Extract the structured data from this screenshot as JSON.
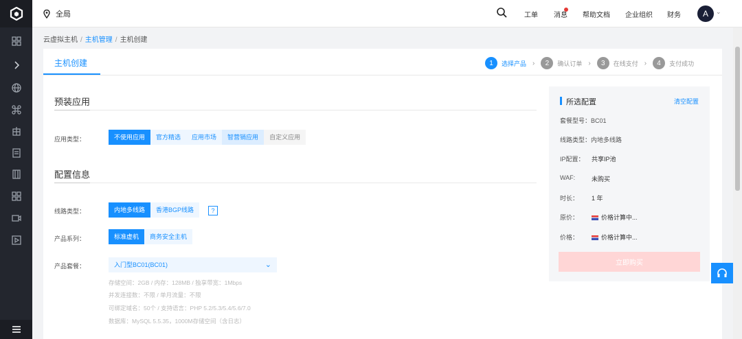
{
  "topbar": {
    "region": "全局",
    "nav": [
      "工单",
      "消息",
      "帮助文档",
      "企业组织",
      "财务"
    ],
    "avatar": "A"
  },
  "sidebar": {
    "icons": [
      "dashboard-icon",
      "expand-icon",
      "globe-icon",
      "command-icon",
      "building-icon",
      "notes-icon",
      "server-icon",
      "grid-icon",
      "video-icon",
      "play-icon"
    ],
    "bottom_icon": "menu-icon"
  },
  "breadcrumb": {
    "items": [
      "云虚拟主机",
      "主机管理",
      "主机创建"
    ],
    "sep": "/"
  },
  "page": {
    "tab": "主机创建"
  },
  "steps": [
    {
      "num": "1",
      "label": "选择产品"
    },
    {
      "num": "2",
      "label": "确认订单"
    },
    {
      "num": "3",
      "label": "在线支付"
    },
    {
      "num": "4",
      "label": "支付成功"
    }
  ],
  "preinstall": {
    "title": "预装应用",
    "label": "应用类型：",
    "options": [
      "不使用应用",
      "官方精选",
      "应用市场",
      "智营销应用",
      "自定义应用"
    ]
  },
  "config": {
    "title": "配置信息",
    "line_label": "线路类型：",
    "line_options": [
      "内地多线路",
      "香港BGP线路"
    ],
    "line_help": "?",
    "series_label": "产品系列：",
    "series_options": [
      "标准虚机",
      "商务安全主机"
    ],
    "package_label": "产品套餐：",
    "package_value": "入门型BC01(BC01)",
    "specs": [
      "存储空间：2GB / 内存：128MB / 独享带宽：1Mbps",
      "并发连接数：不限 / 单月流量：不限",
      "可绑定域名：50个 / 支持语言：PHP 5.2/5.3/5.4/5.6/7.0",
      "数据库：MySQL 5.5.35，1000M存储空间（含日志）"
    ]
  },
  "summary": {
    "title": "所选配置",
    "clear": "清空配置",
    "package": "套餐型号：BC01",
    "line": "线路类型：内地多线路",
    "ip_label": "IP配置：",
    "ip_value": "共享IP池",
    "waf_label": "WAF:",
    "waf_value": "未购买",
    "duration_label": "时长：",
    "duration_value": "1 年",
    "orig_label": "原价：",
    "orig_value": "价格计算中...",
    "price_label": "价格：",
    "price_value": "价格计算中...",
    "buy": "立即购买"
  },
  "colors": {
    "accent": "#1890ff",
    "sidebar": "#23262e",
    "alert": "#e53935"
  }
}
